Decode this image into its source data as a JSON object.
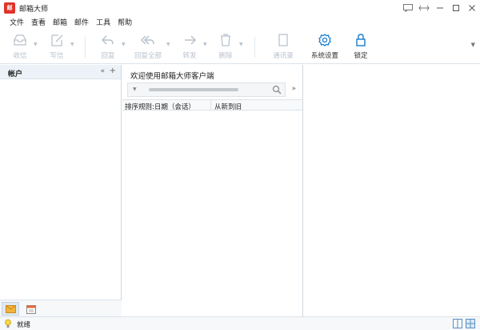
{
  "window": {
    "title": "邮箱大师",
    "logo_text": "邮"
  },
  "menu": [
    "文件",
    "查看",
    "邮箱",
    "邮件",
    "工具",
    "帮助"
  ],
  "toolbar": {
    "receive": "收信",
    "compose": "写信",
    "reply": "回复",
    "reply_all": "回复全部",
    "forward": "转发",
    "delete": "删除",
    "contacts": "通讯录",
    "settings": "系统设置",
    "lock": "锁定"
  },
  "left_pane": {
    "header": "帐户"
  },
  "mid_pane": {
    "welcome": "欢迎使用邮箱大师客户端",
    "search_value": "",
    "sort_rule": "排序规则:日期（会话）",
    "sort_order": "从新到旧"
  },
  "status": {
    "text": "就绪"
  },
  "colors": {
    "accent": "#1a7cc9",
    "brand": "#e0332a",
    "disabled": "#b9c2cc"
  }
}
